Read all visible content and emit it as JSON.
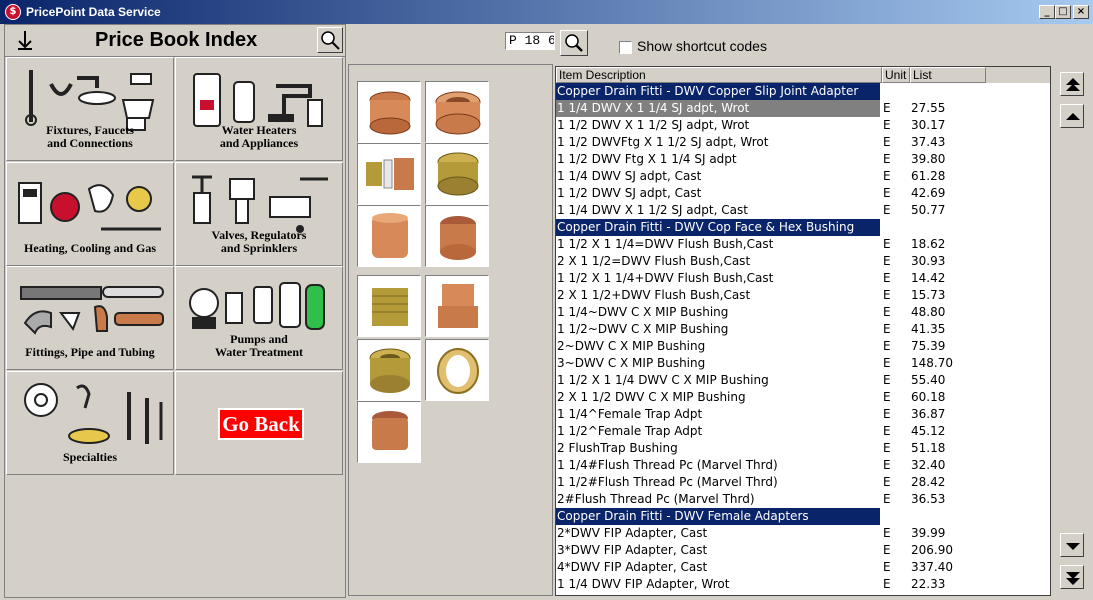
{
  "window": {
    "title": "PricePoint Data Service",
    "icon_letter": "$",
    "minimize": "_",
    "maximize": "□",
    "close": "×"
  },
  "left_panel": {
    "title": "Price Book Index",
    "categories": [
      {
        "label_line1": "Fixtures, Faucets",
        "label_line2": "and Connections"
      },
      {
        "label_line1": "Water Heaters",
        "label_line2": "and Appliances"
      },
      {
        "label_line1": "Heating, Cooling and Gas",
        "label_line2": ""
      },
      {
        "label_line1": "Valves, Regulators",
        "label_line2": "and Sprinklers"
      },
      {
        "label_line1": "Fittings, Pipe and Tubing",
        "label_line2": ""
      },
      {
        "label_line1": "Pumps and",
        "label_line2": "Water Treatment"
      },
      {
        "label_line1": "Specialties",
        "label_line2": ""
      }
    ],
    "go_back": "Go Back"
  },
  "code_box": "P 18 6",
  "toolbar": {
    "shortcut_label": "Show shortcut codes",
    "shortcut_checked": false
  },
  "table": {
    "headers": {
      "description": "Item Description",
      "unit": "Unit",
      "list": "List"
    },
    "rows": [
      {
        "type": "section",
        "description": "Copper Drain Fitti - DWV Copper Slip Joint Adapter"
      },
      {
        "type": "item",
        "selected": true,
        "description": "1 1/4 DWV X 1 1/4  SJ adpt, Wrot",
        "unit": "E",
        "list": "27.55"
      },
      {
        "type": "item",
        "description": "1 1/2 DWV X 1 1/2  SJ adpt, Wrot",
        "unit": "E",
        "list": "30.17"
      },
      {
        "type": "item",
        "description": "1 1/2 DWVFtg X 1 1/2  SJ adpt, Wrot",
        "unit": "E",
        "list": "37.43"
      },
      {
        "type": "item",
        "description": "1 1/2 DWV Ftg X 1 1/4 SJ adpt",
        "unit": "E",
        "list": "39.80"
      },
      {
        "type": "item",
        "description": "1 1/4 DWV SJ adpt, Cast",
        "unit": "E",
        "list": "61.28"
      },
      {
        "type": "item",
        "description": "1 1/2 DWV SJ adpt, Cast",
        "unit": "E",
        "list": "42.69"
      },
      {
        "type": "item",
        "description": "1 1/4 DWV X 1 1/2 SJ adpt, Cast",
        "unit": "E",
        "list": "50.77"
      },
      {
        "type": "section",
        "description": "Copper Drain Fitti - DWV Cop Face & Hex Bushing"
      },
      {
        "type": "item",
        "description": "1 1/2 X 1 1/4=DWV Flush Bush,Cast",
        "unit": "E",
        "list": "18.62"
      },
      {
        "type": "item",
        "description": "2 X 1 1/2=DWV Flush Bush,Cast",
        "unit": "E",
        "list": "30.93"
      },
      {
        "type": "item",
        "description": "1 1/2 X 1 1/4+DWV Flush Bush,Cast",
        "unit": "E",
        "list": "14.42"
      },
      {
        "type": "item",
        "description": "2 X 1 1/2+DWV Flush Bush,Cast",
        "unit": "E",
        "list": "15.73"
      },
      {
        "type": "item",
        "description": "1 1/4~DWV C X MIP Bushing",
        "unit": "E",
        "list": "48.80"
      },
      {
        "type": "item",
        "description": "1 1/2~DWV C X MIP Bushing",
        "unit": "E",
        "list": "41.35"
      },
      {
        "type": "item",
        "description": "2~DWV C X MIP Bushing",
        "unit": "E",
        "list": "75.39"
      },
      {
        "type": "item",
        "description": "3~DWV C X MIP Bushing",
        "unit": "E",
        "list": "148.70"
      },
      {
        "type": "item",
        "description": "1 1/2 X 1 1/4 DWV C X MIP Bushing",
        "unit": "E",
        "list": "55.40"
      },
      {
        "type": "item",
        "description": "2 X 1 1/2 DWV C X MIP Bushing",
        "unit": "E",
        "list": "60.18"
      },
      {
        "type": "item",
        "description": "1 1/4^Female Trap Adpt",
        "unit": "E",
        "list": "36.87"
      },
      {
        "type": "item",
        "description": "1 1/2^Female Trap Adpt",
        "unit": "E",
        "list": "45.12"
      },
      {
        "type": "item",
        "description": "2 FlushTrap Bushing",
        "unit": "E",
        "list": "51.18"
      },
      {
        "type": "item",
        "description": "1 1/4#Flush Thread Pc (Marvel Thrd)",
        "unit": "E",
        "list": "32.40"
      },
      {
        "type": "item",
        "description": "1 1/2#Flush Thread Pc (Marvel Thrd)",
        "unit": "E",
        "list": "28.42"
      },
      {
        "type": "item",
        "description": "2#Flush Thread Pc (Marvel Thrd)",
        "unit": "E",
        "list": "36.53"
      },
      {
        "type": "section",
        "description": "Copper Drain Fitti - DWV  Female Adapters"
      },
      {
        "type": "item",
        "description": "2*DWV FIP Adapter, Cast",
        "unit": "E",
        "list": "39.99"
      },
      {
        "type": "item",
        "description": "3*DWV FIP Adapter, Cast",
        "unit": "E",
        "list": "206.90"
      },
      {
        "type": "item",
        "description": "4*DWV FIP Adapter, Cast",
        "unit": "E",
        "list": "337.40"
      },
      {
        "type": "item",
        "description": "1 1/4 DWV FIP Adapter, Wrot",
        "unit": "E",
        "list": "22.33"
      }
    ]
  },
  "colors": {
    "section_bg": "#0a246a",
    "selected_bg": "#808080",
    "go_back_bg": "#ff0000",
    "copper": "#c87a4a",
    "brass": "#b59a3a"
  },
  "thumbnails": [
    {
      "icon": "copper-adapter-icon",
      "tone": "copper"
    },
    {
      "icon": "copper-adapter-icon",
      "tone": "copper"
    },
    {
      "icon": "slip-joint-kit-icon",
      "tone": "brass"
    },
    {
      "icon": "brass-bushing-icon",
      "tone": "brass"
    },
    {
      "icon": "copper-coupling-icon",
      "tone": "copper"
    },
    {
      "icon": "copper-coupling-icon",
      "tone": "copper"
    },
    {
      "icon": "brass-bushing-icon",
      "tone": "brass"
    },
    {
      "icon": "copper-adapter-icon",
      "tone": "copper"
    },
    {
      "icon": "brass-bushing-icon",
      "tone": "brass"
    },
    {
      "icon": "brass-ring-icon",
      "tone": "brass"
    },
    {
      "icon": "copper-coupling-icon",
      "tone": "copper"
    }
  ]
}
